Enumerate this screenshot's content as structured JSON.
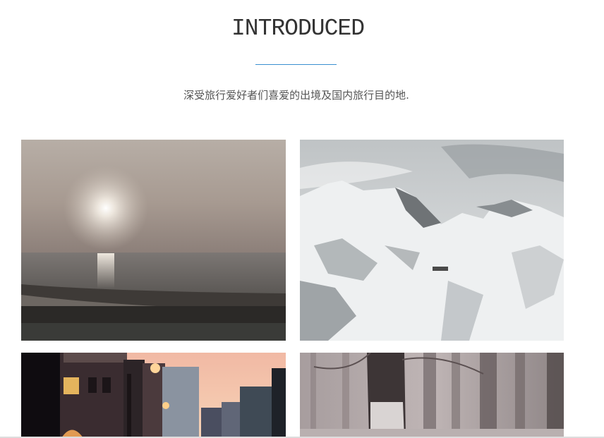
{
  "section": {
    "title": "INTRODUCED",
    "subtitle": "深受旅行爱好者们喜爱的出境及国内旅行目的地."
  },
  "colors": {
    "accent": "#3a8fd0",
    "title_text": "#333333",
    "subtitle_text": "#555555"
  },
  "gallery": {
    "images": [
      {
        "name": "beach-sunset-image"
      },
      {
        "name": "snowy-mountains-image"
      },
      {
        "name": "city-street-dusk-image"
      },
      {
        "name": "misty-forest-image"
      }
    ]
  }
}
